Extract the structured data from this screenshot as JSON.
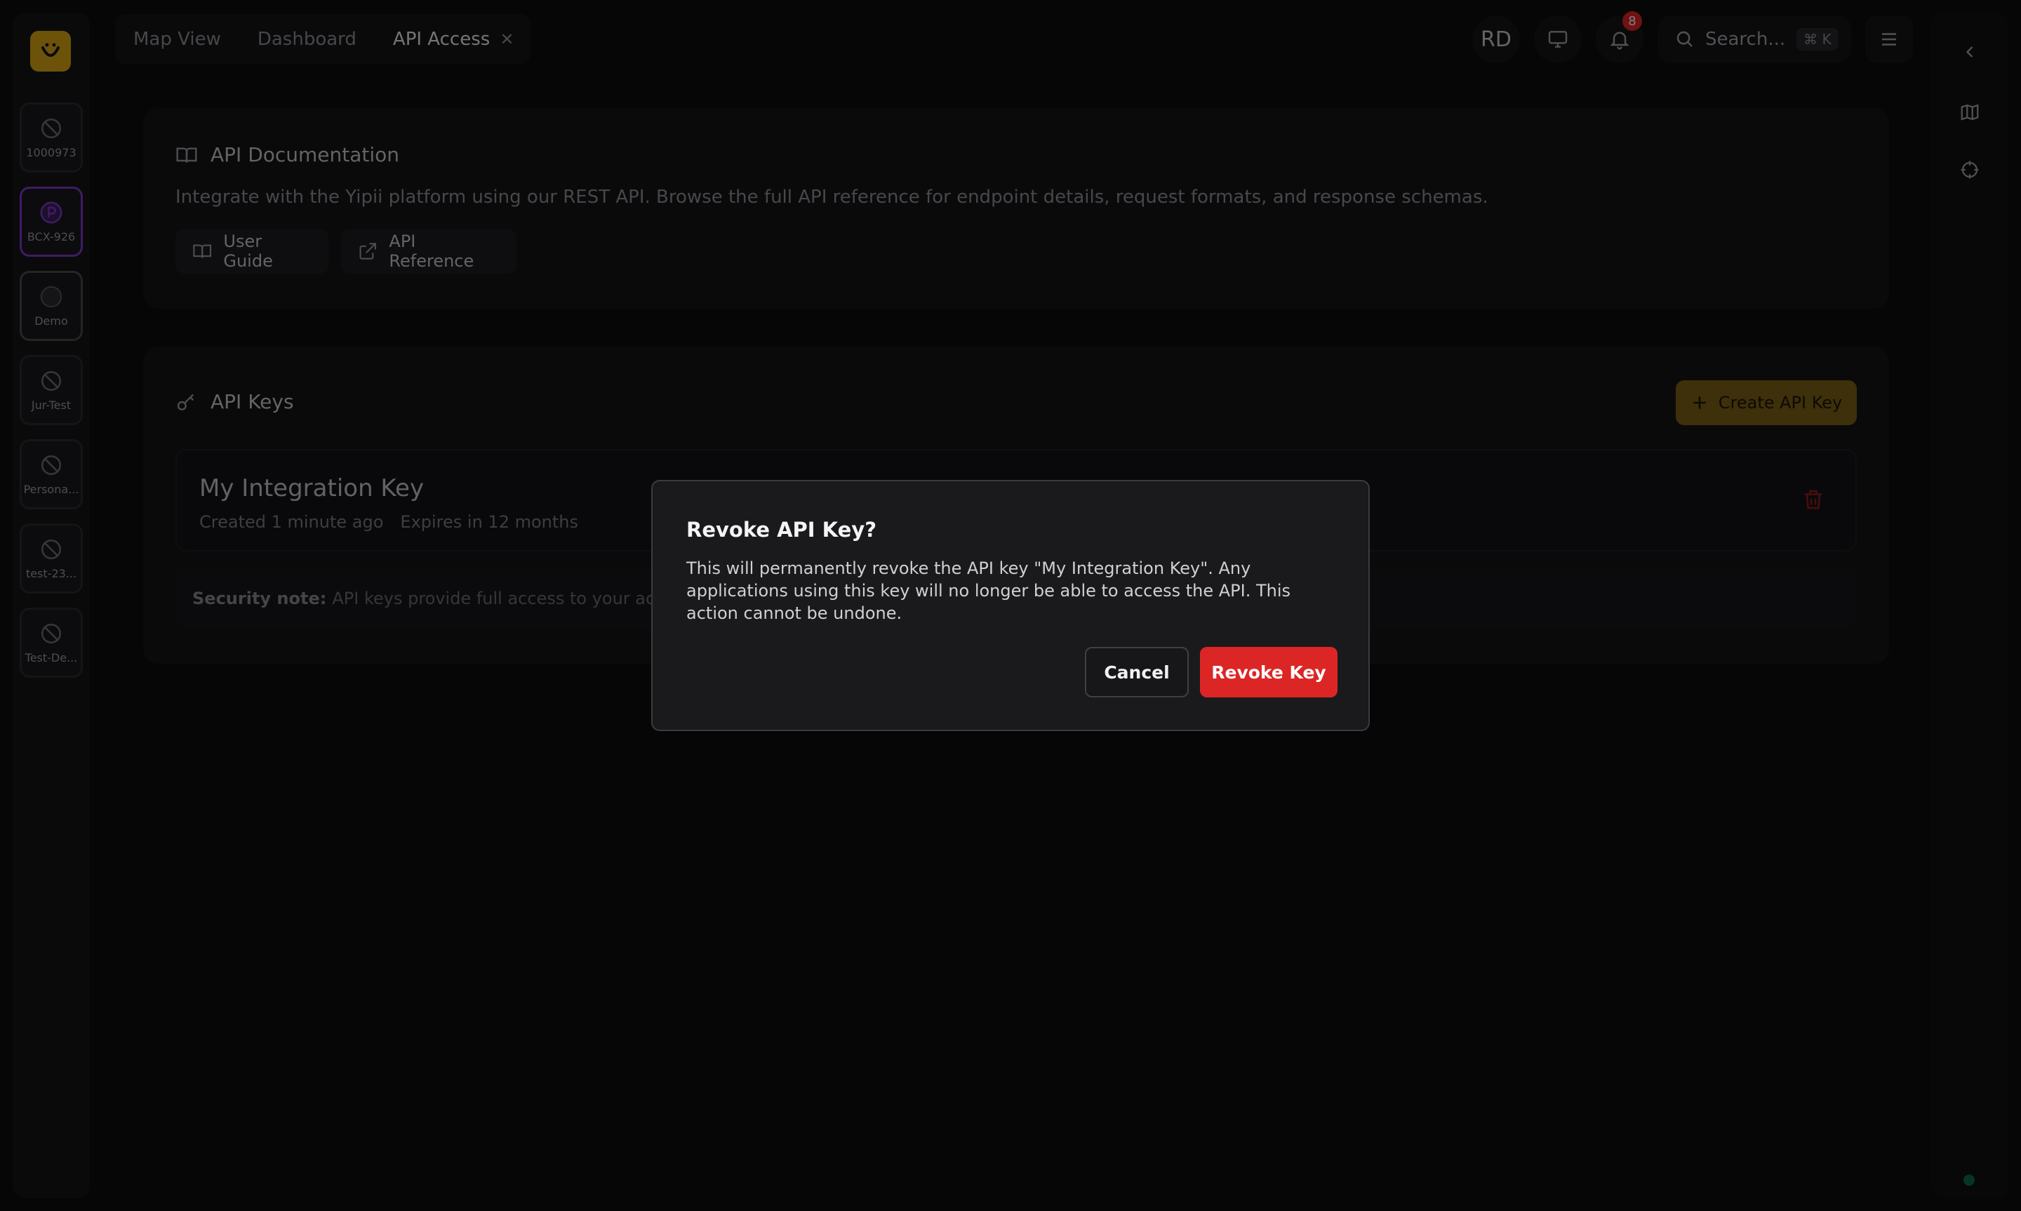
{
  "workspaces": [
    {
      "label": "1000973",
      "icon": "eye-off-icon"
    },
    {
      "label": "BCX-926",
      "icon": "p-circle-icon"
    },
    {
      "label": "Demo",
      "icon": "circle-icon"
    },
    {
      "label": "Jur-Test",
      "icon": "eye-off-icon"
    },
    {
      "label": "Persona...",
      "icon": "eye-off-icon"
    },
    {
      "label": "test-23...",
      "icon": "eye-off-icon"
    },
    {
      "label": "Test-De...",
      "icon": "eye-off-icon"
    }
  ],
  "tabs": [
    {
      "label": "Map View"
    },
    {
      "label": "Dashboard"
    },
    {
      "label": "API Access"
    }
  ],
  "header": {
    "avatar": "RD",
    "notification_count": "8",
    "search_placeholder": "Search...",
    "search_shortcut": "⌘ K"
  },
  "docs": {
    "title": "API Documentation",
    "description": "Integrate with the Yipii platform using our REST API. Browse the full API reference for endpoint details, request formats, and response schemas.",
    "user_guide": "User Guide",
    "api_reference": "API Reference"
  },
  "keys": {
    "title": "API Keys",
    "create_label": "Create API Key",
    "items": [
      {
        "name": "My Integration Key",
        "created": "Created 1 minute ago",
        "expires": "Expires in 12 months"
      }
    ],
    "security_label": "Security note:",
    "security_text": "API keys provide full access to your account."
  },
  "dialog": {
    "title": "Revoke API Key?",
    "body": "This will permanently revoke the API key \"My Integration Key\". Any applications using this key will no longer be able to access the API. This action cannot be undone.",
    "cancel": "Cancel",
    "confirm": "Revoke Key"
  },
  "colors": {
    "accent": "#d8a712",
    "danger": "#dc2626",
    "background": "#0c0c0e"
  }
}
